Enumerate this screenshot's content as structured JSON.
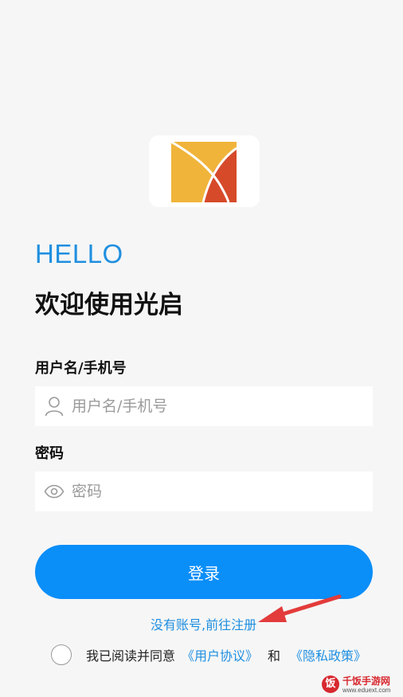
{
  "header": {
    "greeting": "HELLO",
    "welcome": "欢迎使用光启"
  },
  "form": {
    "username_label": "用户名/手机号",
    "username_placeholder": "用户名/手机号",
    "username_icon": "user-icon",
    "password_label": "密码",
    "password_placeholder": "密码",
    "password_icon": "eye-icon",
    "login_button": "登录"
  },
  "register": {
    "link_text": "没有账号,前往注册"
  },
  "agreement": {
    "prefix": "我已阅读并同意",
    "user_agreement": "《用户协议》",
    "and": "和",
    "privacy_policy": "《隐私政策》",
    "checked": false
  },
  "watermark": {
    "badge": "饭",
    "name": "千饭手游网",
    "url": "www.eduext.com"
  },
  "colors": {
    "background": "#f6f6f6",
    "accent": "#1f8fe0",
    "button": "#0a8ef8",
    "logo_yellow": "#f0b43a",
    "logo_red": "#d64a2a",
    "arrow": "#e33b3b"
  }
}
